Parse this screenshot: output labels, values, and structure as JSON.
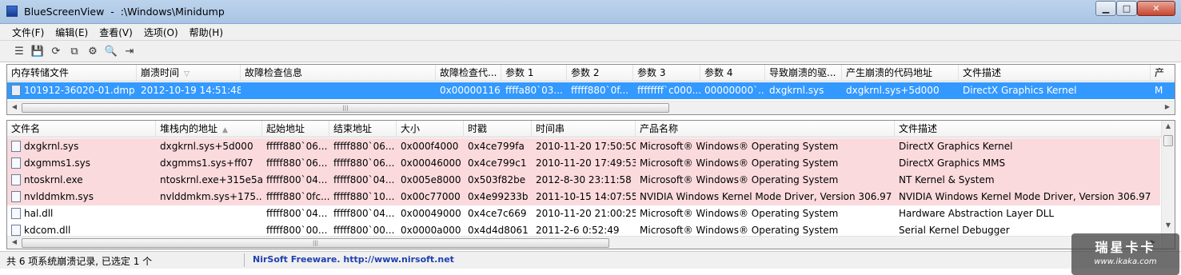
{
  "window": {
    "title": "BlueScreenView  -  :\\Windows\\Minidump",
    "minimize_glyph": "▁",
    "maximize_glyph": "□",
    "close_glyph": "✕"
  },
  "menu": [
    "文件(F)",
    "编辑(E)",
    "查看(V)",
    "选项(O)",
    "帮助(H)"
  ],
  "toolbar": [
    {
      "name": "properties-icon",
      "glyph": "☰"
    },
    {
      "name": "save-icon",
      "glyph": "💾"
    },
    {
      "name": "refresh-icon",
      "glyph": "⟳"
    },
    {
      "name": "copy-icon",
      "glyph": "⧉"
    },
    {
      "name": "advanced-options-icon",
      "glyph": "⚙"
    },
    {
      "name": "find-icon",
      "glyph": "🔍"
    },
    {
      "name": "exit-icon",
      "glyph": "⇥"
    }
  ],
  "crash_table": {
    "columns": [
      "内存转储文件",
      "崩溃时间",
      "故障检查信息",
      "故障检查代...",
      "参数 1",
      "参数 2",
      "参数 3",
      "参数 4",
      "导致崩溃的驱...",
      "产生崩溃的代码地址",
      "文件描述",
      "产"
    ],
    "rows": [
      {
        "dump_file": "101912-36020-01.dmp",
        "crash_time": "2012-10-19 14:51:48",
        "bug_check_string": "",
        "bug_check_code": "0x00000116",
        "param1": "ffffa80`03...",
        "param2": "fffff880`0f...",
        "param3": "ffffffff`c000...",
        "param4": "00000000`...",
        "caused_by_driver": "dxgkrnl.sys",
        "caused_by_address": "dxgkrnl.sys+5d000",
        "file_description": "DirectX Graphics Kernel",
        "product": "M"
      }
    ],
    "sort_column_marker": "▽"
  },
  "driver_table": {
    "columns": [
      "文件名",
      "堆栈内的地址",
      "起始地址",
      "结束地址",
      "大小",
      "时戳",
      "时间串",
      "产品名称",
      "文件描述"
    ],
    "sort_column_marker": "▲",
    "rows": [
      {
        "filename": "dxgkrnl.sys",
        "stack_address": "dxgkrnl.sys+5d000",
        "from_address": "fffff880`06...",
        "to_address": "fffff880`06...",
        "size": "0x000f4000",
        "timestamp": "0x4ce799fa",
        "time_string": "2010-11-20 17:50:50",
        "product_name": "Microsoft® Windows® Operating System",
        "file_description": "DirectX Graphics Kernel",
        "highlight": "pink"
      },
      {
        "filename": "dxgmms1.sys",
        "stack_address": "dxgmms1.sys+ff07",
        "from_address": "fffff880`06...",
        "to_address": "fffff880`06...",
        "size": "0x00046000",
        "timestamp": "0x4ce799c1",
        "time_string": "2010-11-20 17:49:53",
        "product_name": "Microsoft® Windows® Operating System",
        "file_description": "DirectX Graphics MMS",
        "highlight": "pink"
      },
      {
        "filename": "ntoskrnl.exe",
        "stack_address": "ntoskrnl.exe+315e5a",
        "from_address": "fffff800`04...",
        "to_address": "fffff800`04...",
        "size": "0x005e8000",
        "timestamp": "0x503f82be",
        "time_string": "2012-8-30 23:11:58",
        "product_name": "Microsoft® Windows® Operating System",
        "file_description": "NT Kernel & System",
        "highlight": "pink"
      },
      {
        "filename": "nvlddmkm.sys",
        "stack_address": "nvlddmkm.sys+175...",
        "from_address": "fffff880`0fc...",
        "to_address": "fffff880`10...",
        "size": "0x00c77000",
        "timestamp": "0x4e99233b",
        "time_string": "2011-10-15 14:07:55",
        "product_name": "NVIDIA Windows Kernel Mode Driver, Version 306.97",
        "file_description": "NVIDIA Windows Kernel Mode Driver, Version 306.97",
        "highlight": "pink"
      },
      {
        "filename": "hal.dll",
        "stack_address": "",
        "from_address": "fffff800`04...",
        "to_address": "fffff800`04...",
        "size": "0x00049000",
        "timestamp": "0x4ce7c669",
        "time_string": "2010-11-20 21:00:25",
        "product_name": "Microsoft® Windows® Operating System",
        "file_description": "Hardware Abstraction Layer DLL",
        "highlight": "none"
      },
      {
        "filename": "kdcom.dll",
        "stack_address": "",
        "from_address": "fffff800`00...",
        "to_address": "fffff800`00...",
        "size": "0x0000a000",
        "timestamp": "0x4d4d8061",
        "time_string": "2011-2-6 0:52:49",
        "product_name": "Microsoft® Windows® Operating System",
        "file_description": "Serial Kernel Debugger",
        "highlight": "none"
      }
    ]
  },
  "statusbar": {
    "count_text": "共 6 项系统崩溃记录, 已选定 1 个",
    "link_text": "NirSoft Freeware.  http://www.nirsoft.net"
  },
  "watermark": {
    "title": "瑞星卡卡",
    "url": "www.ikaka.com"
  },
  "colors": {
    "selection": "#3399ff",
    "highlight_pink": "#fadadd",
    "link": "#1f3fb0"
  }
}
